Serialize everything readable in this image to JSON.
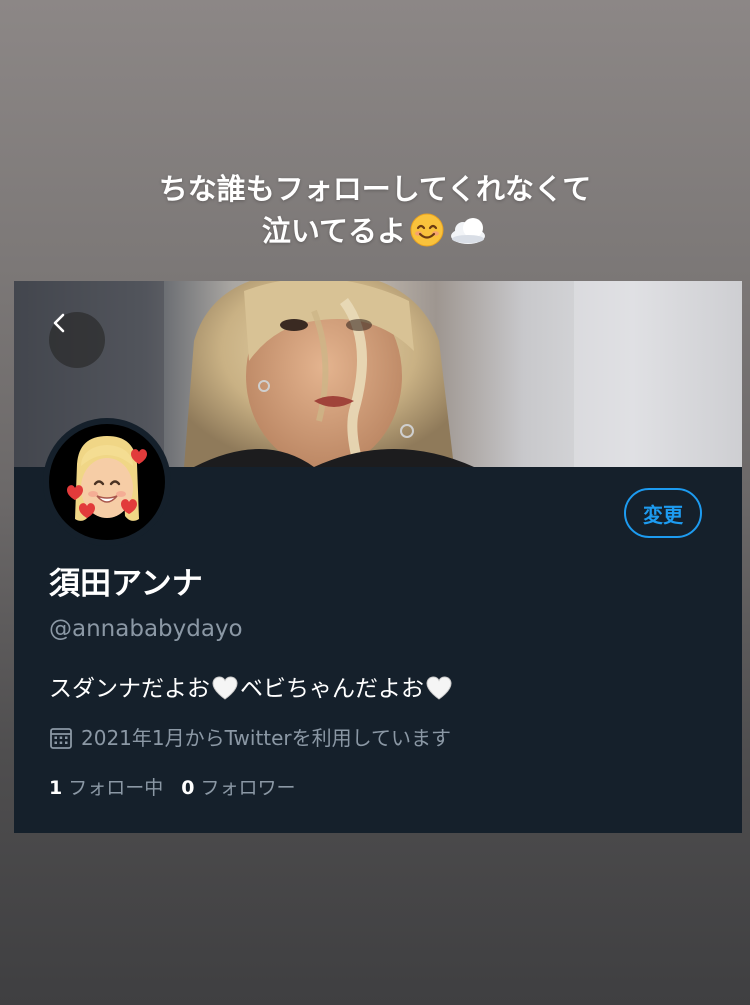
{
  "story_caption": {
    "line1": "ちな誰もフォローしてくれなくて",
    "line2": "泣いてるよ"
  },
  "profile": {
    "back_icon": "chevron-left-icon",
    "edit_button_label": "変更",
    "display_name": "須田アンナ",
    "handle": "@annababydayo",
    "bio_part1": "スダンナだよお",
    "bio_part2": "ベビちゃんだよお",
    "joined_text": "2021年1月からTwitterを利用しています",
    "following_count": "1",
    "following_label": "フォロー中",
    "followers_count": "0",
    "followers_label": "フォロワー"
  },
  "colors": {
    "card_background": "#15202b",
    "accent": "#1d9bf0",
    "secondary_text": "#8b98a5",
    "primary_text": "#ffffff"
  }
}
